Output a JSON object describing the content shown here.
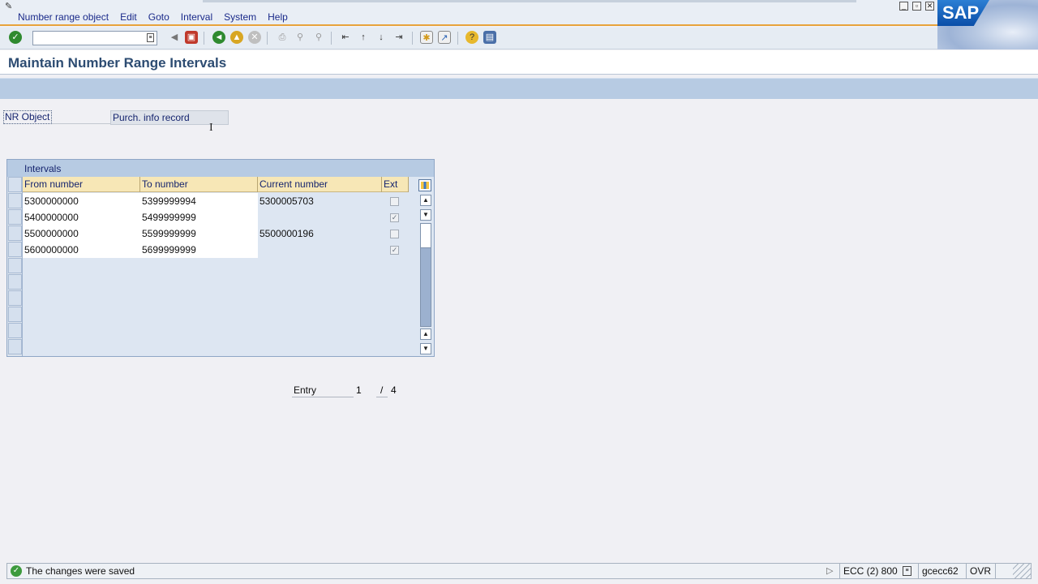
{
  "menu": {
    "items": [
      "Number range object",
      "Edit",
      "Goto",
      "Interval",
      "System",
      "Help"
    ]
  },
  "sap_logo": "SAP",
  "toolbar": {
    "command_field": {
      "value": "",
      "placeholder": ""
    },
    "icons": [
      "enter-icon",
      "back-arrow-icon",
      "save-icon",
      "back-icon",
      "exit-icon",
      "cancel-icon",
      "print-icon",
      "find-icon",
      "find-next-icon",
      "first-page-icon",
      "previous-page-icon",
      "next-page-icon",
      "last-page-icon",
      "create-session-icon",
      "shortcut-icon",
      "help-icon",
      "customize-layout-icon"
    ]
  },
  "page": {
    "title": "Maintain Number Range Intervals"
  },
  "fields": {
    "nr_object_label": "NR Object",
    "nr_object_value": "Purch. info record"
  },
  "table": {
    "title": "Intervals",
    "columns": [
      "From number",
      "To number",
      "Current number",
      "Ext"
    ],
    "rows": [
      {
        "from": "5300000000",
        "to": "5399999994",
        "current": "5300005703",
        "ext": false
      },
      {
        "from": "5400000000",
        "to": "5499999999",
        "current": "",
        "ext": true
      },
      {
        "from": "5500000000",
        "to": "5599999999",
        "current": "5500000196",
        "ext": false
      },
      {
        "from": "5600000000",
        "to": "5699999999",
        "current": "",
        "ext": true
      }
    ]
  },
  "entry": {
    "label": "Entry",
    "current": "1",
    "separator": "/",
    "total": "4"
  },
  "status": {
    "message": "The changes were saved",
    "system": "ECC (2) 800",
    "server": "gcecc62",
    "mode": "OVR"
  },
  "colors": {
    "accent": "#e8a33c",
    "header_bg": "#b7cbe3",
    "title_text": "#2d4c72",
    "status_ok": "#3d9a3d"
  }
}
